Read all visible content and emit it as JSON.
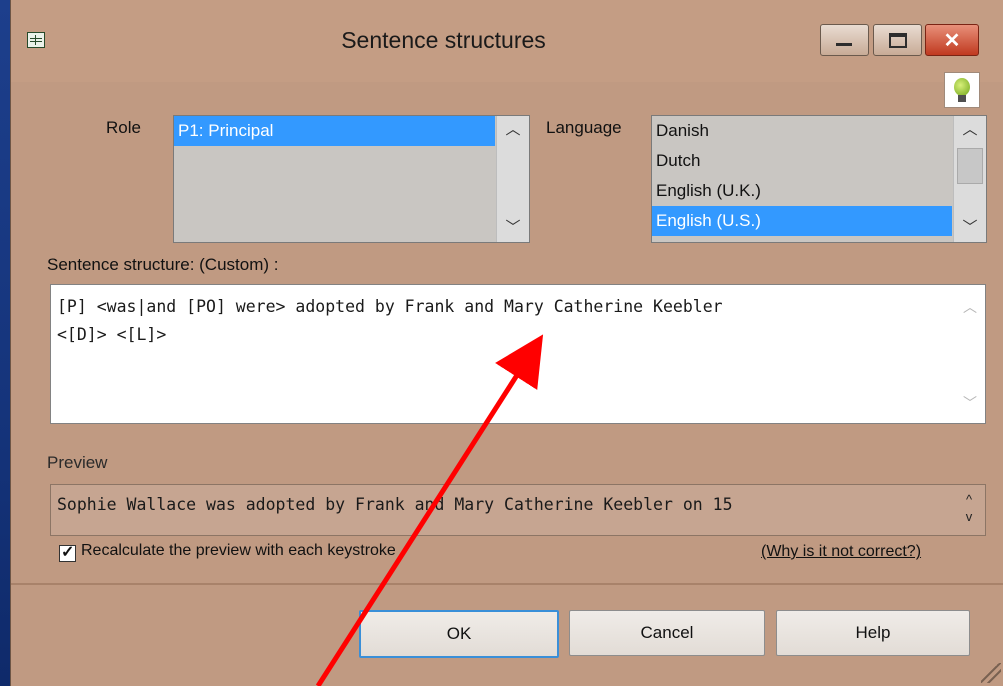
{
  "window": {
    "title": "Sentence structures"
  },
  "role": {
    "label": "Role",
    "items": [
      "P1: Principal"
    ],
    "selected": "P1: Principal"
  },
  "language": {
    "label": "Language",
    "items": [
      "Danish",
      "Dutch",
      "English (U.K.)",
      "English (U.S.)"
    ],
    "selected": "English (U.S.)"
  },
  "sentence": {
    "label": "Sentence structure: (Custom) :",
    "value": "[P] <was|and [PO] were> adopted by Frank and Mary Catherine Keebler\n<[D]> <[L]>"
  },
  "preview": {
    "label": "Preview",
    "text": "Sophie Wallace was adopted by Frank and Mary Catherine Keebler on 15"
  },
  "options": {
    "recalculate_label": "Recalculate the preview with each keystroke",
    "recalculate_checked": true,
    "why_link": "(Why is it not correct?)"
  },
  "buttons": {
    "ok": "OK",
    "cancel": "Cancel",
    "help": "Help"
  },
  "colors": {
    "dialog_bg": "#c09a82",
    "selection": "#3399ff",
    "annotation_arrow": "#ff0000"
  }
}
